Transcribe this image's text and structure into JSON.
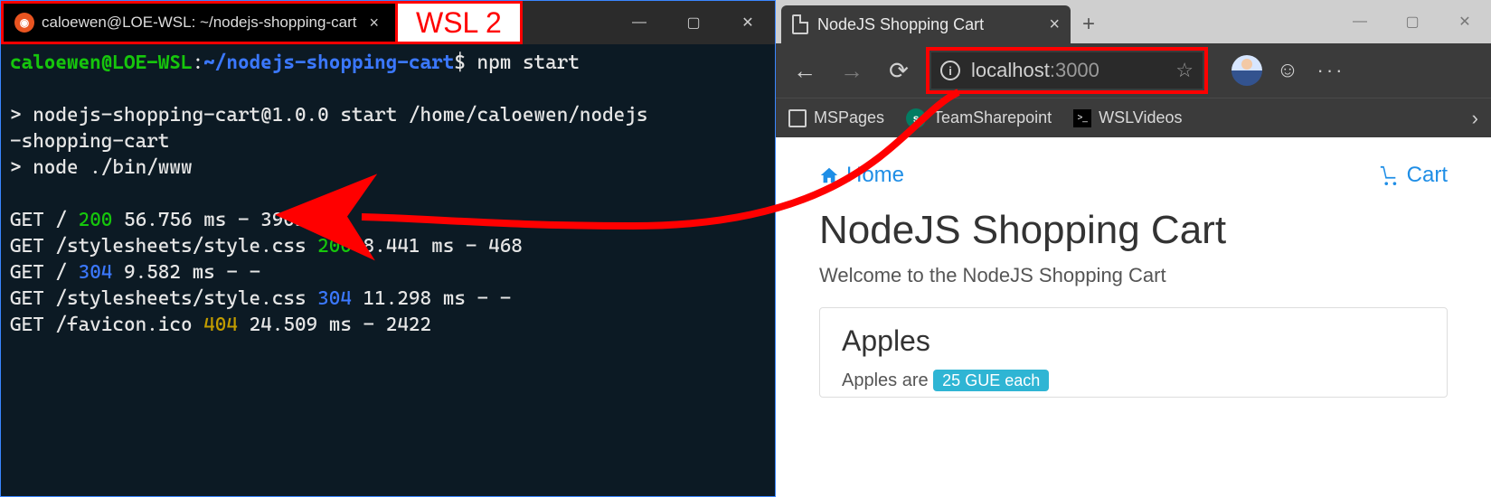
{
  "terminal": {
    "tab_title": "caloewen@LOE-WSL: ~/nodejs-shopping-cart",
    "wsl_label": "WSL 2",
    "prompt_user": "caloewen@LOE-WSL",
    "prompt_sep": ":",
    "prompt_path": "~/nodejs-shopping-cart",
    "prompt_sym": "$",
    "command": "npm start",
    "line_blank": "",
    "line2a": "> nodejs-shopping-cart@1.0.0 start /home/caloewen/nodejs",
    "line2b": "-shopping-cart",
    "line3": "> node ./bin/www",
    "logs": [
      {
        "method": "GET",
        "path": "/",
        "status": "200",
        "status_color": "green",
        "ms": "56.756",
        "bytes": "3903"
      },
      {
        "method": "GET",
        "path": "/stylesheets/style.css",
        "status": "200",
        "status_color": "green",
        "ms": "8.441",
        "bytes": "468"
      },
      {
        "method": "GET",
        "path": "/",
        "status": "304",
        "status_color": "blue",
        "ms": "9.582",
        "bytes": "-"
      },
      {
        "method": "GET",
        "path": "/stylesheets/style.css",
        "status": "304",
        "status_color": "blue",
        "ms": "11.298",
        "bytes": "-"
      },
      {
        "method": "GET",
        "path": "/favicon.ico",
        "status": "404",
        "status_color": "yellow",
        "ms": "24.509",
        "bytes": "2422"
      }
    ]
  },
  "browser": {
    "tab_title": "NodeJS Shopping Cart",
    "url_host": "localhost",
    "url_port": ":3000",
    "bookmarks": {
      "b1": "MSPages",
      "b2": "TeamSharepoint",
      "b3": "WSLVideos"
    },
    "page": {
      "nav_home": "Home",
      "nav_cart": "Cart",
      "title": "NodeJS Shopping Cart",
      "subtitle": "Welcome to the NodeJS Shopping Cart",
      "card_title": "Apples",
      "card_text_prefix": "Apples are ",
      "card_badge": "25 GUE each"
    }
  }
}
